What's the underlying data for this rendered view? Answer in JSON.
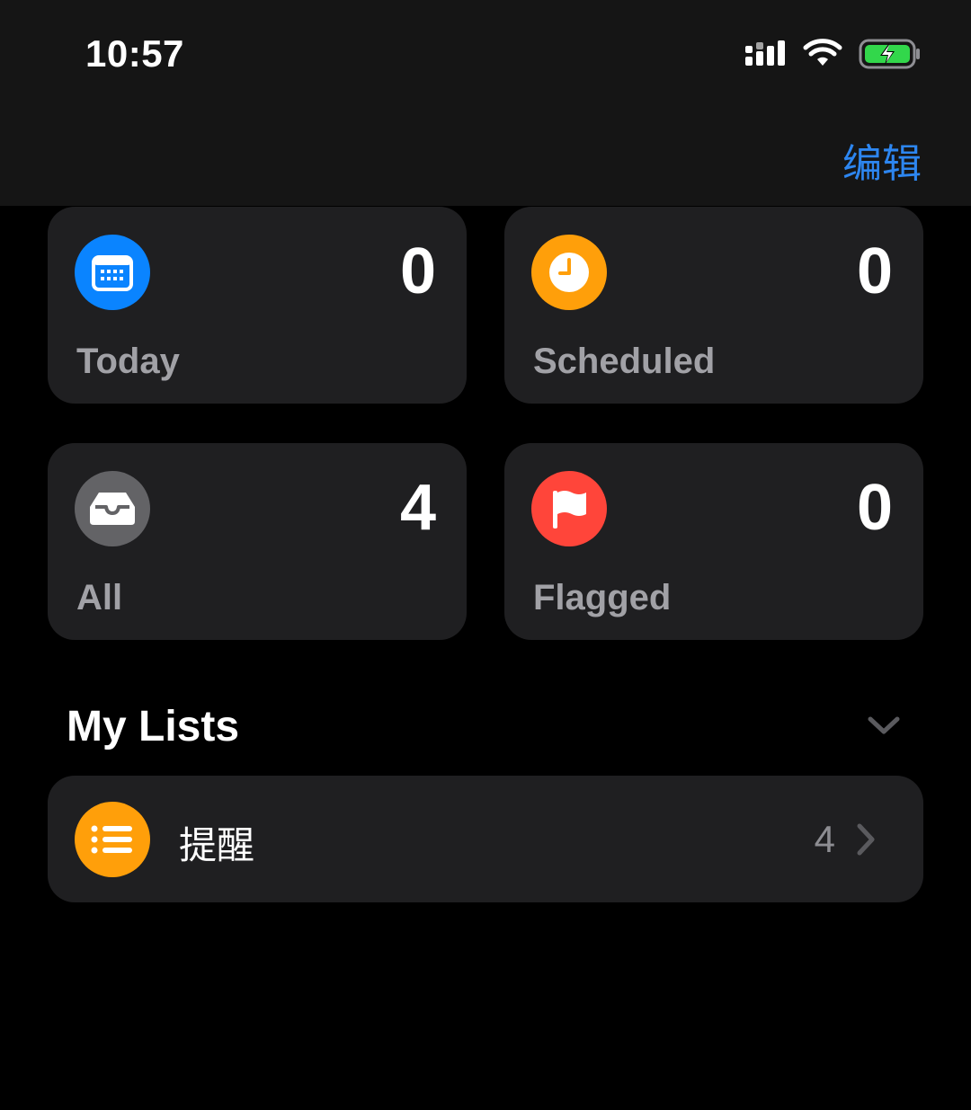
{
  "status_bar": {
    "time": "10:57",
    "icons": [
      "signal-icon",
      "wifi-icon",
      "battery-charging-icon"
    ]
  },
  "nav": {
    "edit_label": "编辑",
    "accent_color": "#2d86f0"
  },
  "smart_lists": [
    {
      "label": "Today",
      "count": "0",
      "icon": "calendar-icon",
      "color": "#0a84ff"
    },
    {
      "label": "Scheduled",
      "count": "0",
      "icon": "clock-icon",
      "color": "#ff9f0a"
    },
    {
      "label": "All",
      "count": "4",
      "icon": "tray-icon",
      "color": "#636366"
    },
    {
      "label": "Flagged",
      "count": "0",
      "icon": "flag-icon",
      "color": "#ff453a"
    }
  ],
  "my_lists": {
    "title": "My Lists",
    "items": [
      {
        "name": "提醒",
        "count": "4",
        "icon": "list-bullet-icon",
        "color": "#ff9f0a"
      }
    ]
  }
}
